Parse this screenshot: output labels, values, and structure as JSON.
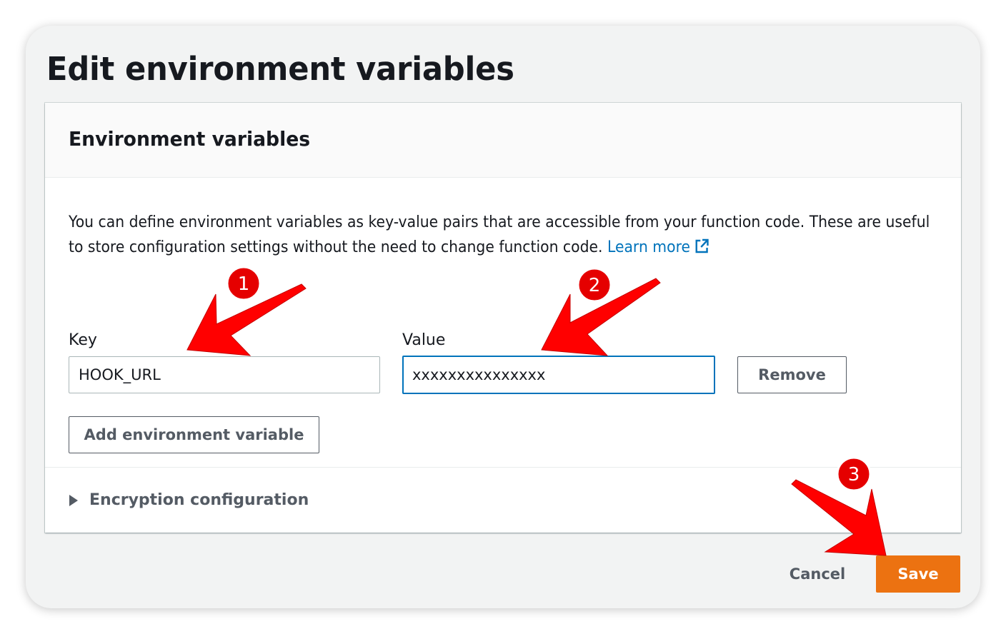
{
  "dialog": {
    "title": "Edit environment variables"
  },
  "panel": {
    "title": "Environment variables",
    "description": "You can define environment variables as key-value pairs that are accessible from your function code. These are useful to store configuration settings without the need to change function code.",
    "learn_more_label": "Learn more",
    "learn_more_icon": "external-link-icon"
  },
  "variables": {
    "key_label": "Key",
    "value_label": "Value",
    "rows": [
      {
        "key": "HOOK_URL",
        "value": "xxxxxxxxxxxxxxx",
        "remove_label": "Remove"
      }
    ],
    "add_label": "Add environment variable"
  },
  "encryption": {
    "label": "Encryption configuration",
    "expanded": false
  },
  "footer": {
    "cancel_label": "Cancel",
    "save_label": "Save"
  },
  "annotations": {
    "badges": [
      "1",
      "2",
      "3"
    ],
    "color": "#e50000"
  },
  "colors": {
    "primary": "#ec7211",
    "link": "#0073bb",
    "focus_border": "#0073bb",
    "frame_bg": "#f2f3f3"
  }
}
